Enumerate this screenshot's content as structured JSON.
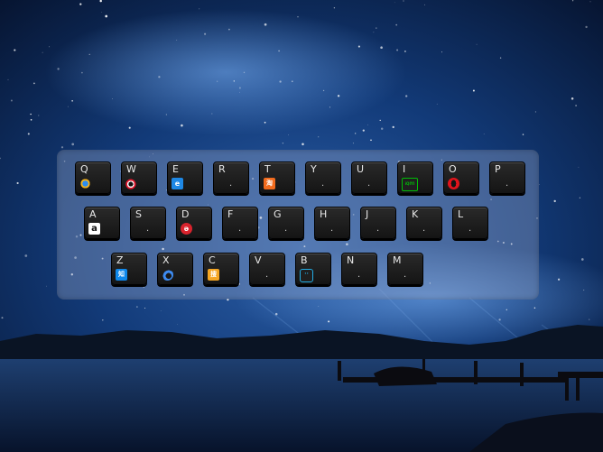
{
  "keyboard": {
    "keys": [
      {
        "letter": "Q",
        "icon": "browser-globe-icon",
        "dot": "."
      },
      {
        "letter": "W",
        "icon": "weibo-icon",
        "dot": "."
      },
      {
        "letter": "E",
        "icon": "e-browser-icon",
        "dot": "."
      },
      {
        "letter": "R",
        "icon": "",
        "dot": "."
      },
      {
        "letter": "T",
        "icon": "orange-square-icon",
        "dot": "."
      },
      {
        "letter": "Y",
        "icon": "",
        "dot": "."
      },
      {
        "letter": "U",
        "icon": "",
        "dot": "."
      },
      {
        "letter": "I",
        "icon": "iqiyi-icon",
        "dot": "."
      },
      {
        "letter": "O",
        "icon": "opera-icon",
        "dot": "."
      },
      {
        "letter": "P",
        "icon": "",
        "dot": "."
      },
      {
        "letter": "A",
        "icon": "amazon-icon",
        "dot": "."
      },
      {
        "letter": "S",
        "icon": "",
        "dot": "."
      },
      {
        "letter": "D",
        "icon": "red-circle-app-icon",
        "dot": "."
      },
      {
        "letter": "F",
        "icon": "",
        "dot": "."
      },
      {
        "letter": "G",
        "icon": "",
        "dot": "."
      },
      {
        "letter": "H",
        "icon": "",
        "dot": "."
      },
      {
        "letter": "J",
        "icon": "",
        "dot": "."
      },
      {
        "letter": "K",
        "icon": "",
        "dot": "."
      },
      {
        "letter": "L",
        "icon": "",
        "dot": "."
      },
      {
        "letter": "Z",
        "icon": "zhihu-icon",
        "dot": "."
      },
      {
        "letter": "X",
        "icon": "blue-swirl-icon",
        "dot": "."
      },
      {
        "letter": "C",
        "icon": "sohu-icon",
        "dot": "."
      },
      {
        "letter": "V",
        "icon": "",
        "dot": "."
      },
      {
        "letter": "B",
        "icon": "bilibili-icon",
        "dot": "."
      },
      {
        "letter": "N",
        "icon": "",
        "dot": "."
      },
      {
        "letter": "M",
        "icon": "",
        "dot": "."
      }
    ]
  },
  "icon_labels": {
    "amazon": "a",
    "zhihu": "知",
    "iqiyi": "iQIYI",
    "sohu": "搜",
    "orange": "淘"
  },
  "colors": {
    "panel": "#96a5c8",
    "key": "#1c1c1c",
    "letter": "#e8e8e8"
  }
}
